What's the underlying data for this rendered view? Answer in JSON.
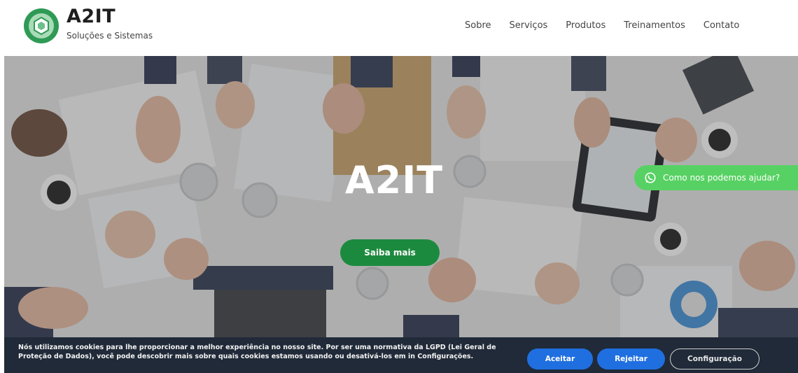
{
  "header": {
    "brand_name": "A2IT",
    "brand_tagline": "Soluções e Sistemas",
    "logo_icon": "hexagon-logo-icon",
    "nav": [
      "Sobre",
      "Serviços",
      "Produtos",
      "Treinamentos",
      "Contato"
    ]
  },
  "hero": {
    "title": "A2IT",
    "button_label": "Saiba mais",
    "background": "meeting-table-photo"
  },
  "whatsapp": {
    "label": "Como nos podemos ajudar?",
    "icon": "whatsapp-icon"
  },
  "cookie": {
    "text": "Nós utilizamos cookies para lhe proporcionar a melhor experiência no nosso site. Por ser uma normativa da LGPD (Lei Geral de Proteção de Dados), você pode descobrir mais sobre quais cookies estamos usando ou desativá-los em in Configurações.",
    "accept_label": "Aceitar",
    "reject_label": "Rejeitar",
    "config_label": "Configuração"
  },
  "colors": {
    "accent_green": "#1c8a3e",
    "whatsapp_green": "#57d163",
    "cookie_bg": "#202a38",
    "cookie_button": "#1f6fe0"
  }
}
